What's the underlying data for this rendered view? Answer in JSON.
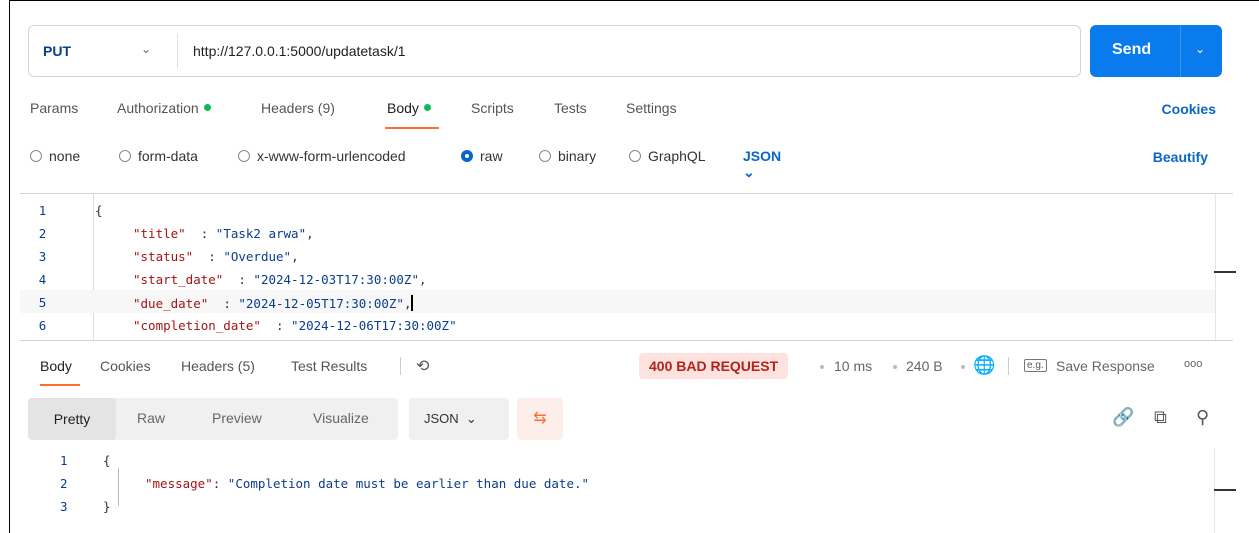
{
  "request": {
    "method": "PUT",
    "url": "http://127.0.0.1:5000/updatetask/1",
    "send_label": "Send"
  },
  "req_tabs": {
    "params": "Params",
    "authorization": "Authorization",
    "headers": "Headers (9)",
    "body": "Body",
    "scripts": "Scripts",
    "tests": "Tests",
    "settings": "Settings",
    "cookies": "Cookies"
  },
  "body_types": {
    "none": "none",
    "form_data": "form-data",
    "urlencoded": "x-www-form-urlencoded",
    "raw": "raw",
    "binary": "binary",
    "graphql": "GraphQL",
    "format": "JSON",
    "beautify": "Beautify"
  },
  "editor": {
    "line_numbers": [
      "1",
      "2",
      "3",
      "4",
      "5",
      "6"
    ],
    "open_brace": "{",
    "lines": [
      {
        "key": "\"title\"",
        "sep": "  : ",
        "value": "\"Task2 arwa\"",
        "end": ","
      },
      {
        "key": "\"status\"",
        "sep": "  : ",
        "value": "\"Overdue\"",
        "end": ","
      },
      {
        "key": "\"start_date\"",
        "sep": "  : ",
        "value": "\"2024-12-03T17:30:00Z\"",
        "end": ","
      },
      {
        "key": "\"due_date\"",
        "sep": "  : ",
        "value": "\"2024-12-05T17:30:00Z\"",
        "end": ","
      },
      {
        "key": "\"completion_date\"",
        "sep": "  : ",
        "value": "\"2024-12-06T17:30:00Z\"",
        "end": ""
      }
    ]
  },
  "response_tabs": {
    "body": "Body",
    "cookies": "Cookies",
    "headers": "Headers (5)",
    "test_results": "Test Results"
  },
  "response_meta": {
    "status": "400 BAD REQUEST",
    "time": "10 ms",
    "size": "240 B",
    "save": "Save Response",
    "more": "ooo"
  },
  "response_view": {
    "pretty": "Pretty",
    "raw": "Raw",
    "preview": "Preview",
    "visualize": "Visualize",
    "format": "JSON"
  },
  "response_body": {
    "line_numbers": [
      "1",
      "2",
      "3"
    ],
    "open": "{",
    "key": "\"message\"",
    "sep": ": ",
    "value": "\"Completion date must be earlier than due date.\"",
    "close": "}"
  },
  "colors": {
    "send": "#097bed",
    "accent": "#ff6c37",
    "status_bg": "#fde2e0",
    "status_fg": "#b42318"
  }
}
